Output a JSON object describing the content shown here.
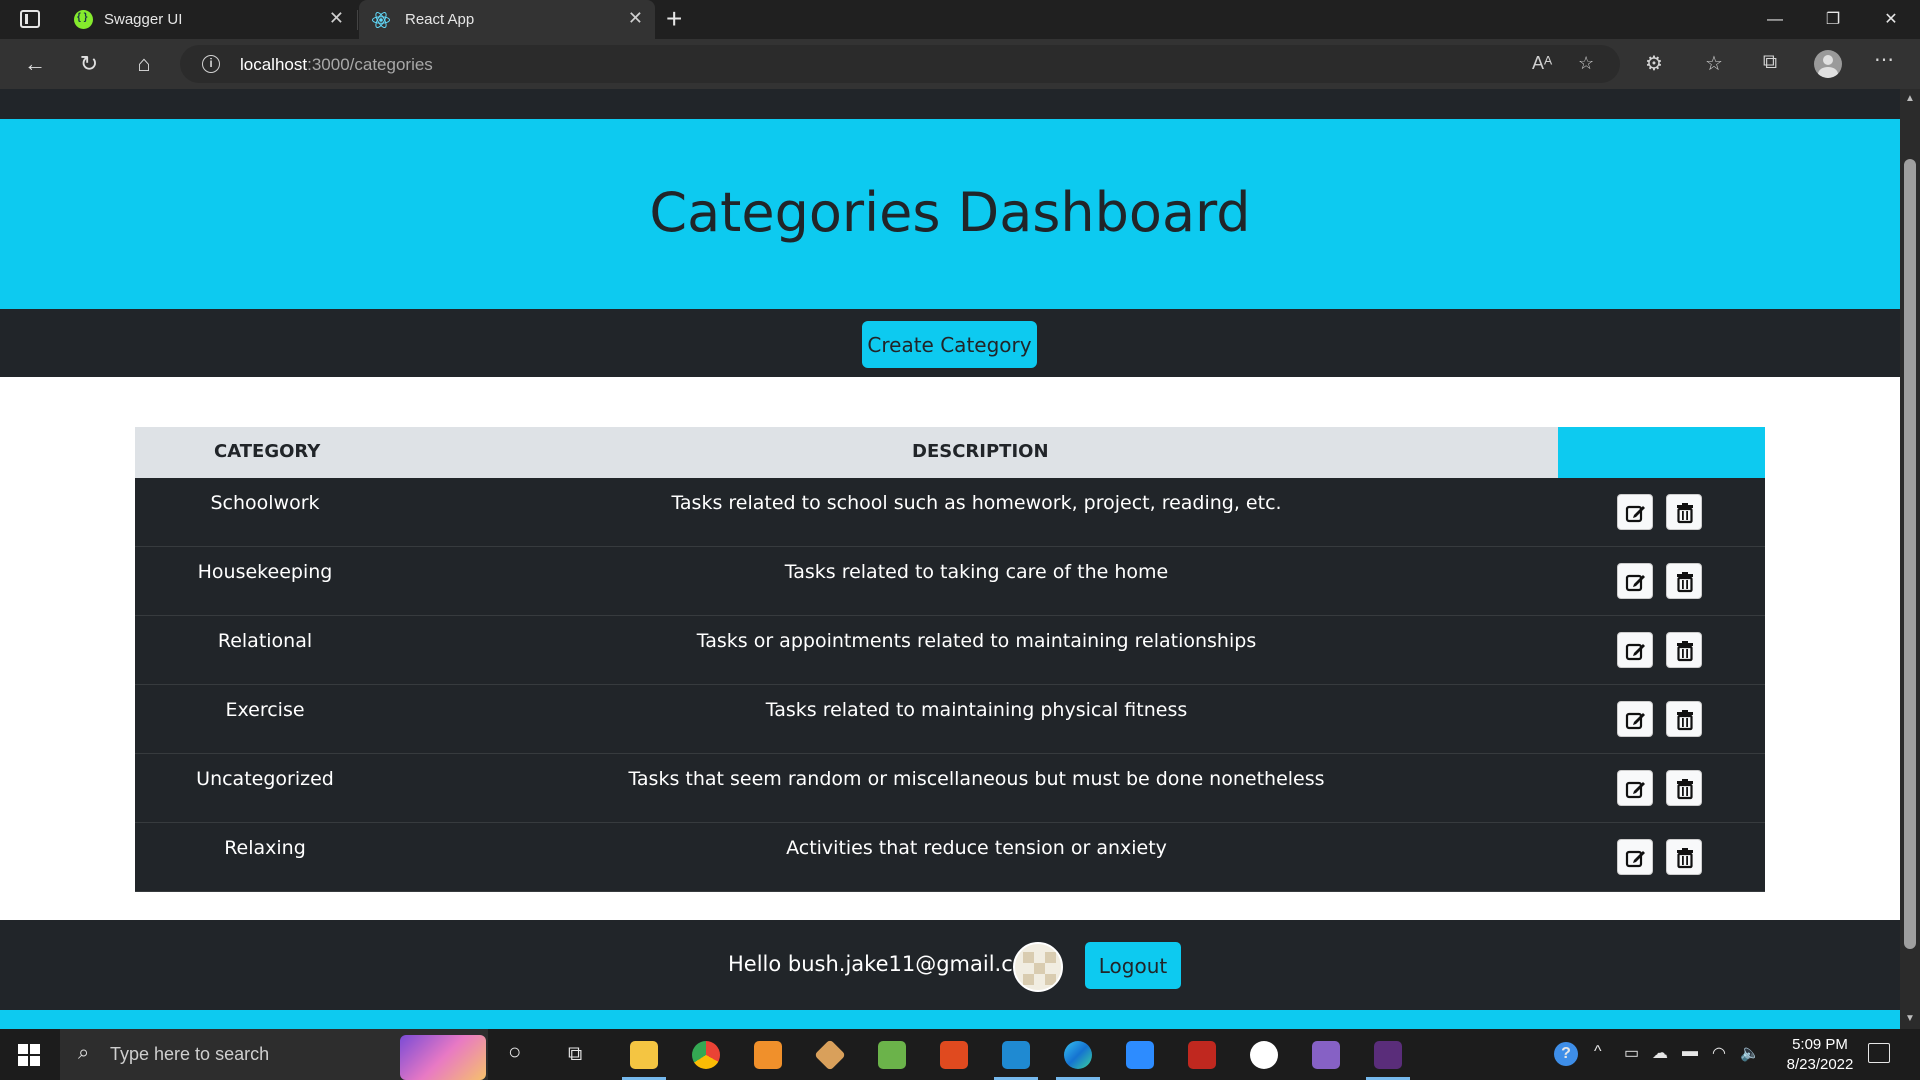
{
  "browser": {
    "tabs": [
      {
        "title": "Swagger UI",
        "favicon": "swagger-icon",
        "active": false
      },
      {
        "title": "React App",
        "favicon": "react-icon",
        "active": true
      }
    ],
    "url_host": "localhost",
    "url_rest": ":3000/categories",
    "window_controls": [
      "minimize",
      "restore",
      "close"
    ]
  },
  "page": {
    "title": "Categories Dashboard",
    "create_button": "Create Category",
    "table": {
      "headers": [
        "CATEGORY",
        "DESCRIPTION"
      ],
      "rows": [
        {
          "category": "Schoolwork",
          "description": "Tasks related to school such as homework, project, reading, etc."
        },
        {
          "category": "Housekeeping",
          "description": "Tasks related to taking care of the home"
        },
        {
          "category": "Relational",
          "description": "Tasks or appointments related to maintaining relationships"
        },
        {
          "category": "Exercise",
          "description": "Tasks related to maintaining physical fitness"
        },
        {
          "category": "Uncategorized",
          "description": "Tasks that seem random or miscellaneous but must be done nonetheless"
        },
        {
          "category": "Relaxing",
          "description": "Activities that reduce tension or anxiety"
        }
      ]
    },
    "footer": {
      "greeting": "Hello bush.jake11@gmail.com!",
      "logout_button": "Logout"
    },
    "colors": {
      "accent": "#0dcaf0",
      "dark": "#212529",
      "header_gray": "#dee2e6"
    }
  },
  "taskbar": {
    "search_placeholder": "Type here to search",
    "time": "5:09 PM",
    "date": "8/23/2022"
  }
}
